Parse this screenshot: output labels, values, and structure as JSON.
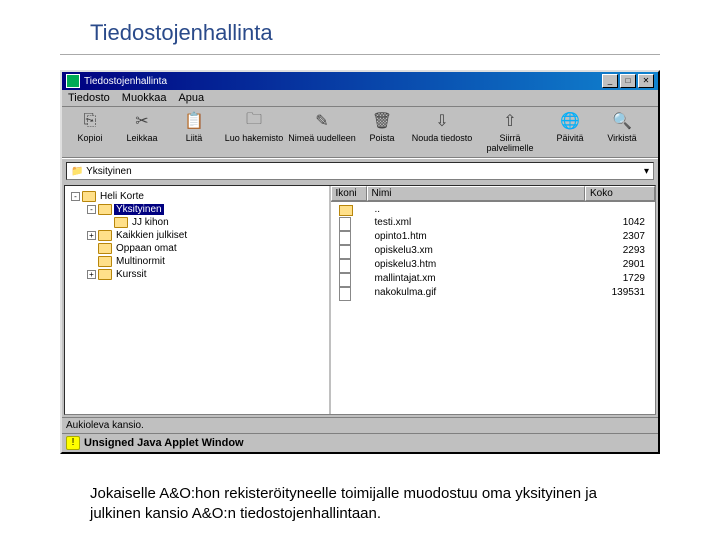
{
  "page": {
    "title": "Tiedostojenhallinta",
    "caption": "Jokaiselle A&O:hon rekisteröityneelle toimijalle muodostuu oma yksityinen ja julkinen kansio A&O:n tiedostojenhallintaan."
  },
  "window": {
    "title": "Tiedostojenhallinta",
    "menu": [
      "Tiedosto",
      "Muokkaa",
      "Apua"
    ],
    "toolbar": [
      {
        "label": "Kopioi",
        "glyph": "⎘"
      },
      {
        "label": "Leikkaa",
        "glyph": "✂"
      },
      {
        "label": "Liitä",
        "glyph": "📋"
      },
      {
        "label": "Luo hakemisto",
        "glyph": "🗀"
      },
      {
        "label": "Nimeä uudelleen",
        "glyph": "✎"
      },
      {
        "label": "Poista",
        "glyph": "🗑"
      },
      {
        "label": "Nouda tiedosto",
        "glyph": "⇩"
      },
      {
        "label": "Siirrä palvelimelle",
        "glyph": "⇧"
      },
      {
        "label": "Päivitä",
        "glyph": "🌐"
      },
      {
        "label": "Virkistä",
        "glyph": "🔍"
      }
    ],
    "path_label": "Yksityinen",
    "tree": [
      {
        "indent": 0,
        "expander": "-",
        "label": "Heli Korte",
        "selected": false
      },
      {
        "indent": 1,
        "expander": "-",
        "label": "Yksityinen",
        "selected": true
      },
      {
        "indent": 2,
        "expander": "",
        "label": "JJ kihon",
        "selected": false
      },
      {
        "indent": 1,
        "expander": "+",
        "label": "Kaikkien julkiset",
        "selected": false
      },
      {
        "indent": 1,
        "expander": "",
        "label": "Oppaan omat",
        "selected": false
      },
      {
        "indent": 1,
        "expander": "",
        "label": "Multinormit",
        "selected": false
      },
      {
        "indent": 1,
        "expander": "+",
        "label": "Kurssit",
        "selected": false
      }
    ],
    "list_cols": {
      "icon": "Ikoni",
      "name": "Nimi",
      "size": "Koko"
    },
    "files": [
      {
        "type": "up",
        "name": "..",
        "size": ""
      },
      {
        "type": "file",
        "name": "testi.xml",
        "size": "1042"
      },
      {
        "type": "file",
        "name": "opinto1.htm",
        "size": "2307"
      },
      {
        "type": "file",
        "name": "opiskelu3.xm",
        "size": "2293"
      },
      {
        "type": "file",
        "name": "opiskelu3.htm",
        "size": "2901"
      },
      {
        "type": "file",
        "name": "mallintajat.xm",
        "size": "1729"
      },
      {
        "type": "file",
        "name": "nakokulma.gif",
        "size": "139531"
      }
    ],
    "status": "Aukioleva kansio.",
    "applet_warning": "Unsigned Java Applet Window"
  }
}
